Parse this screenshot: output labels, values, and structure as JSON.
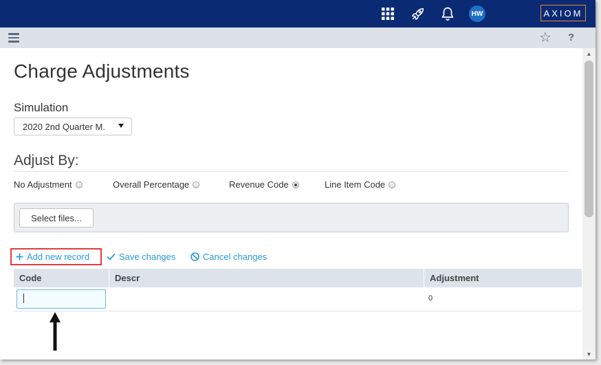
{
  "topbar": {
    "icons": [
      "apps-grid-icon",
      "rocket-icon",
      "bell-icon"
    ],
    "avatar_initials": "HW",
    "logo_text": "AXIOM",
    "colors": {
      "background": "#0b2a74",
      "logo_border": "#e98a2e",
      "avatar": "#1f6fc5"
    }
  },
  "subbar": {
    "icons": [
      "hamburger-menu-icon",
      "star-icon",
      "help-icon"
    ],
    "help_glyph": "?"
  },
  "page": {
    "title": "Charge Adjustments",
    "simulation": {
      "label": "Simulation",
      "selected": "2020 2nd Quarter M."
    },
    "adjust_by": {
      "label": "Adjust By:",
      "options": [
        {
          "label": "No Adjustment",
          "checked": false
        },
        {
          "label": "Overall Percentage",
          "checked": false
        },
        {
          "label": "Revenue Code",
          "checked": true
        },
        {
          "label": "Line Item Code",
          "checked": false
        }
      ]
    },
    "upload": {
      "button_label": "Select files..."
    },
    "toolbar": {
      "add_label": "Add new record",
      "save_label": "Save changes",
      "cancel_label": "Cancel changes",
      "accent_color": "#2a9ad8",
      "highlight_color": "#e03c3c"
    },
    "grid": {
      "columns": [
        "Code",
        "Descr",
        "Adjustment"
      ],
      "rows": [
        {
          "code": "",
          "descr": "",
          "adjustment": "0"
        }
      ]
    }
  }
}
